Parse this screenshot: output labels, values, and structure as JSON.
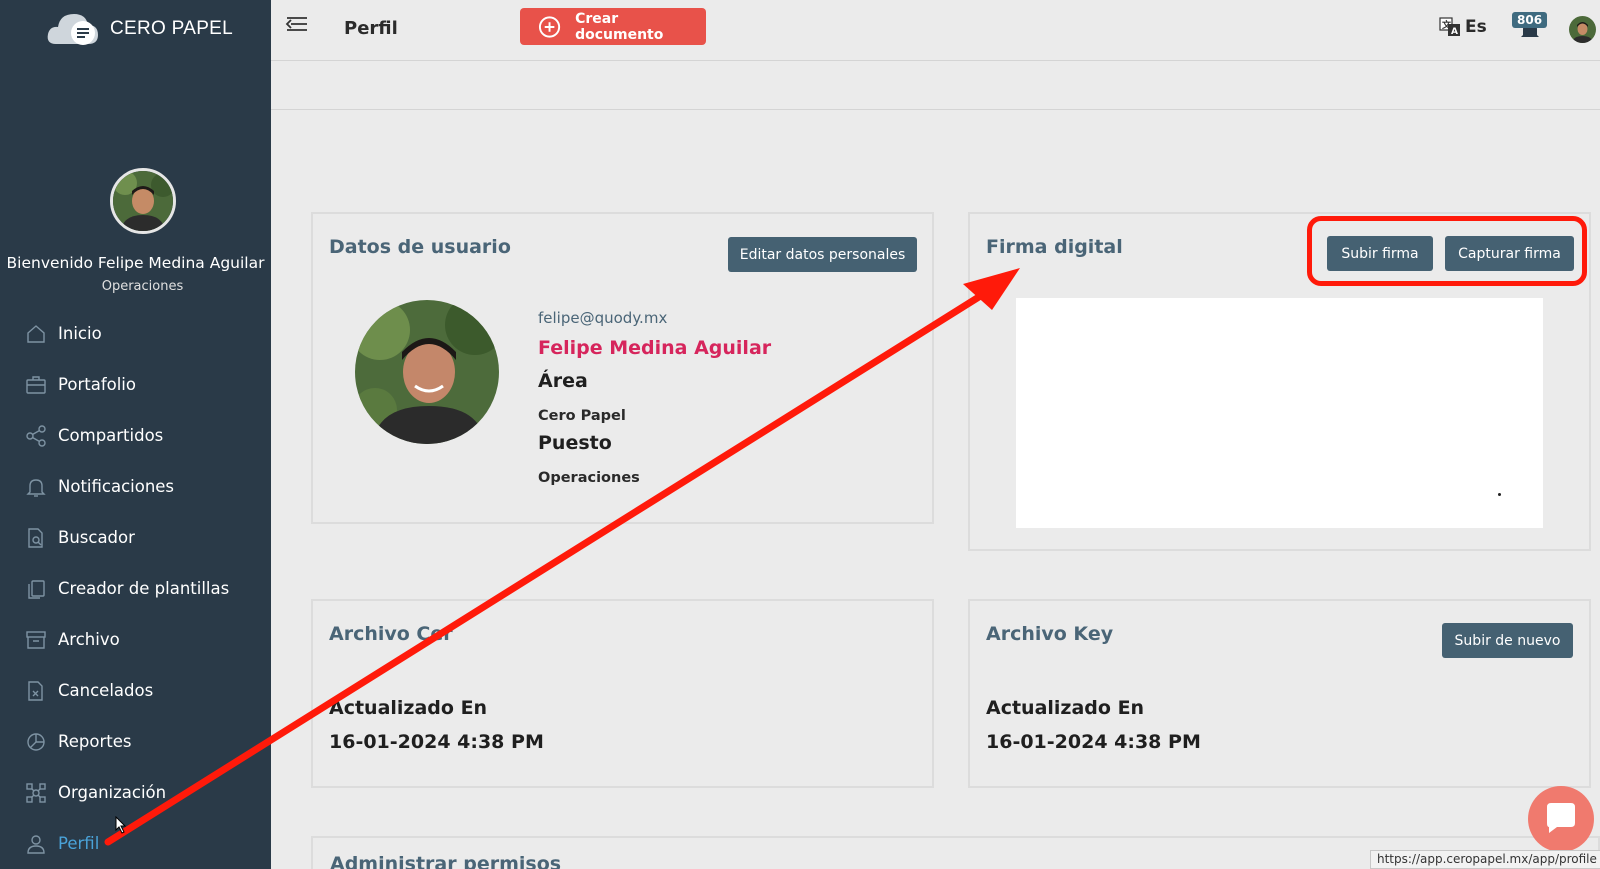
{
  "app": {
    "brand": "CERO PAPEL"
  },
  "sidebar": {
    "welcome": "Bienvenido Felipe Medina Aguilar",
    "role": "Operaciones",
    "items": [
      {
        "label": "Inicio",
        "icon": "home-icon"
      },
      {
        "label": "Portafolio",
        "icon": "briefcase-icon"
      },
      {
        "label": "Compartidos",
        "icon": "share-icon"
      },
      {
        "label": "Notificaciones",
        "icon": "bell-icon"
      },
      {
        "label": "Buscador",
        "icon": "document-search-icon"
      },
      {
        "label": "Creador de plantillas",
        "icon": "copy-icon"
      },
      {
        "label": "Archivo",
        "icon": "archive-box-icon"
      },
      {
        "label": "Cancelados",
        "icon": "cancelled-file-icon"
      },
      {
        "label": "Reportes",
        "icon": "pie-chart-icon"
      },
      {
        "label": "Organización",
        "icon": "network-icon"
      },
      {
        "label": "Perfil",
        "icon": "user-icon",
        "active": true
      }
    ]
  },
  "header": {
    "title": "Perfil",
    "create_button": "Crear documento",
    "language": "Es",
    "notifications_count": "806"
  },
  "user_card": {
    "title": "Datos de usuario",
    "edit_button": "Editar datos personales",
    "email": "felipe@quody.mx",
    "name": "Felipe Medina Aguilar",
    "area_label": "Área",
    "area_value": "Cero Papel",
    "position_label": "Puesto",
    "position_value": "Operaciones"
  },
  "signature_card": {
    "title": "Firma digital",
    "upload_button": "Subir firma",
    "capture_button": "Capturar firma"
  },
  "cer_card": {
    "title": "Archivo Cer",
    "updated_label": "Actualizado En",
    "updated_value": "16-01-2024 4:38 PM"
  },
  "key_card": {
    "title": "Archivo Key",
    "reupload_button": "Subir de nuevo",
    "updated_label": "Actualizado En",
    "updated_value": "16-01-2024 4:38 PM"
  },
  "permissions_card": {
    "title": "Administrar permisos"
  },
  "status_url": "https://app.ceropapel.mx/app/profile",
  "colors": {
    "sidebar": "#2a3a48",
    "accent_red": "#e8524a",
    "button": "#456172",
    "name": "#d6255c",
    "annotation": "#ff1a0a"
  }
}
